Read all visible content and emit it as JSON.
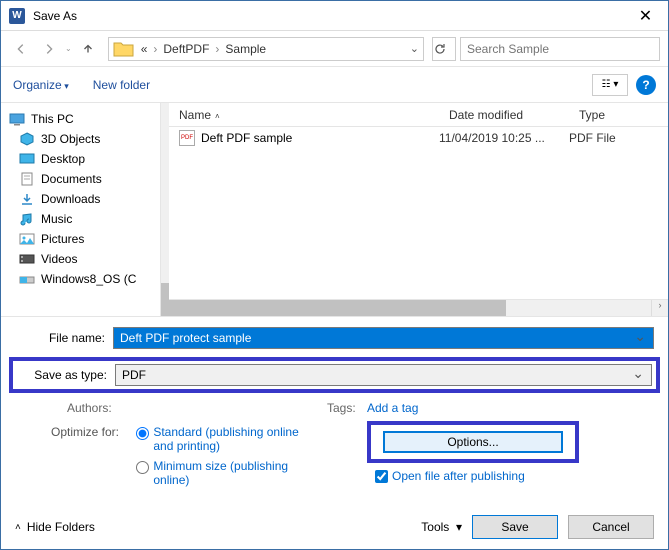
{
  "title": "Save As",
  "breadcrumb": {
    "root": "«",
    "p1": "DeftPDF",
    "p2": "Sample"
  },
  "search": {
    "placeholder": "Search Sample"
  },
  "toolbar": {
    "organize": "Organize",
    "newfolder": "New folder"
  },
  "sidebar": {
    "root": "This PC",
    "items": [
      {
        "label": "3D Objects"
      },
      {
        "label": "Desktop"
      },
      {
        "label": "Documents"
      },
      {
        "label": "Downloads"
      },
      {
        "label": "Music"
      },
      {
        "label": "Pictures"
      },
      {
        "label": "Videos"
      },
      {
        "label": "Windows8_OS (C"
      }
    ]
  },
  "columns": {
    "name": "Name",
    "date": "Date modified",
    "type": "Type"
  },
  "files": [
    {
      "name": "Deft PDF sample",
      "date": "11/04/2019 10:25 ...",
      "type": "PDF File"
    }
  ],
  "filename": {
    "label": "File name:",
    "value": "Deft PDF protect sample"
  },
  "saveastype": {
    "label": "Save as type:",
    "value": "PDF"
  },
  "meta": {
    "authors_label": "Authors:",
    "tags_label": "Tags:",
    "tags_value": "Add a tag"
  },
  "optimize": {
    "label": "Optimize for:",
    "opt1": "Standard (publishing online and printing)",
    "opt2": "Minimum size (publishing online)"
  },
  "options_button": "Options...",
  "openafter": "Open file after publishing",
  "footer": {
    "hide": "Hide Folders",
    "tools": "Tools",
    "save": "Save",
    "cancel": "Cancel"
  }
}
